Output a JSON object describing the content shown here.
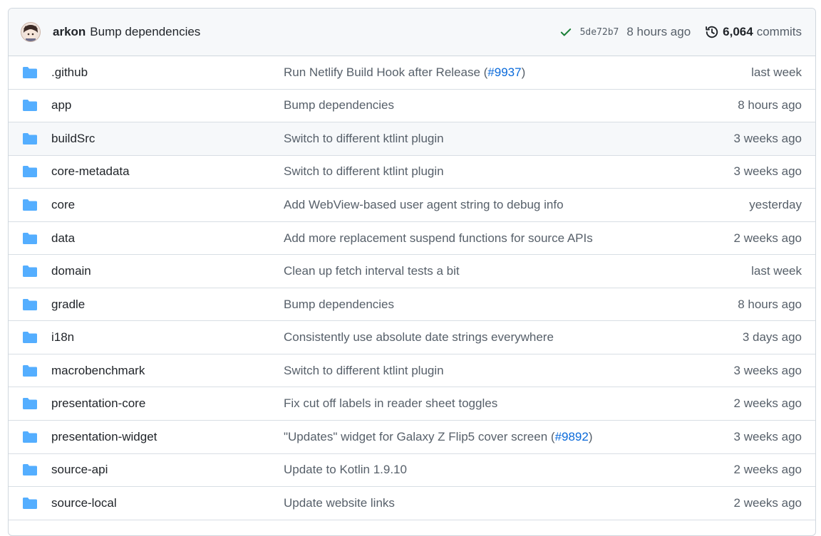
{
  "latest_commit": {
    "avatar_icon": "user-avatar-icon",
    "author": "arkon",
    "message": "Bump dependencies",
    "status_icon": "check-icon",
    "sha": "5de72b7",
    "time": "8 hours ago",
    "history_icon": "history-icon",
    "commit_count": "6,064",
    "commit_label": "commits"
  },
  "colors": {
    "folder": "#54aeff",
    "link": "#0969da",
    "success": "#1a7f37"
  },
  "rows": [
    {
      "name": ".github",
      "message": "Run Netlify Build Hook after Release (",
      "pr": "#9937",
      "message_end": ")",
      "age": "last week"
    },
    {
      "name": "app",
      "message": "Bump dependencies",
      "pr": "",
      "message_end": "",
      "age": "8 hours ago"
    },
    {
      "name": "buildSrc",
      "message": "Switch to different ktlint plugin",
      "pr": "",
      "message_end": "",
      "age": "3 weeks ago"
    },
    {
      "name": "core-metadata",
      "message": "Switch to different ktlint plugin",
      "pr": "",
      "message_end": "",
      "age": "3 weeks ago"
    },
    {
      "name": "core",
      "message": "Add WebView-based user agent string to debug info",
      "pr": "",
      "message_end": "",
      "age": "yesterday"
    },
    {
      "name": "data",
      "message": "Add more replacement suspend functions for source APIs",
      "pr": "",
      "message_end": "",
      "age": "2 weeks ago"
    },
    {
      "name": "domain",
      "message": "Clean up fetch interval tests a bit",
      "pr": "",
      "message_end": "",
      "age": "last week"
    },
    {
      "name": "gradle",
      "message": "Bump dependencies",
      "pr": "",
      "message_end": "",
      "age": "8 hours ago"
    },
    {
      "name": "i18n",
      "message": "Consistently use absolute date strings everywhere",
      "pr": "",
      "message_end": "",
      "age": "3 days ago"
    },
    {
      "name": "macrobenchmark",
      "message": "Switch to different ktlint plugin",
      "pr": "",
      "message_end": "",
      "age": "3 weeks ago"
    },
    {
      "name": "presentation-core",
      "message": "Fix cut off labels in reader sheet toggles",
      "pr": "",
      "message_end": "",
      "age": "2 weeks ago"
    },
    {
      "name": "presentation-widget",
      "message": "\"Updates\" widget for Galaxy Z Flip5 cover screen (",
      "pr": "#9892",
      "message_end": ")",
      "age": "3 weeks ago"
    },
    {
      "name": "source-api",
      "message": "Update to Kotlin 1.9.10",
      "pr": "",
      "message_end": "",
      "age": "2 weeks ago"
    },
    {
      "name": "source-local",
      "message": "Update website links",
      "pr": "",
      "message_end": "",
      "age": "2 weeks ago"
    }
  ]
}
